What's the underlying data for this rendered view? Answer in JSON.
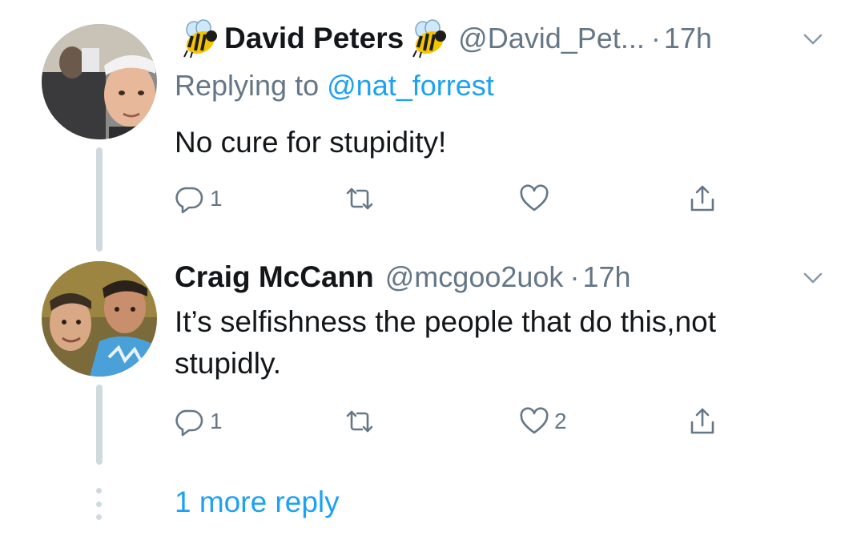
{
  "tweets": [
    {
      "name": "David Peters",
      "name_emoji_left": "bee-emoji",
      "name_emoji_right": "bee-emoji",
      "handle": "@David_Pet...",
      "separator": "·",
      "time": "17h",
      "replying_prefix": "Replying to",
      "replying_to": "@nat_forrest",
      "text": "No cure for stupidity!",
      "reply_count": "1",
      "retweet_count": "",
      "like_count": "",
      "icons": [
        "reply-icon",
        "retweet-icon",
        "like-icon",
        "share-icon",
        "chevron-down-icon"
      ]
    },
    {
      "name": "Craig McCann",
      "handle": "@mcgoo2uok",
      "separator": "·",
      "time": "17h",
      "text_line1": "It’s selfishness the people that do this,not",
      "text_line2": "stupidly.",
      "reply_count": "1",
      "retweet_count": "",
      "like_count": "2",
      "icons": [
        "reply-icon",
        "retweet-icon",
        "like-icon",
        "share-icon",
        "chevron-down-icon"
      ]
    }
  ],
  "more_replies_label": "1 more reply",
  "colors": {
    "text": "#14171a",
    "secondary": "#657786",
    "link": "#1da1f2",
    "thread_line": "#cfd9de"
  }
}
